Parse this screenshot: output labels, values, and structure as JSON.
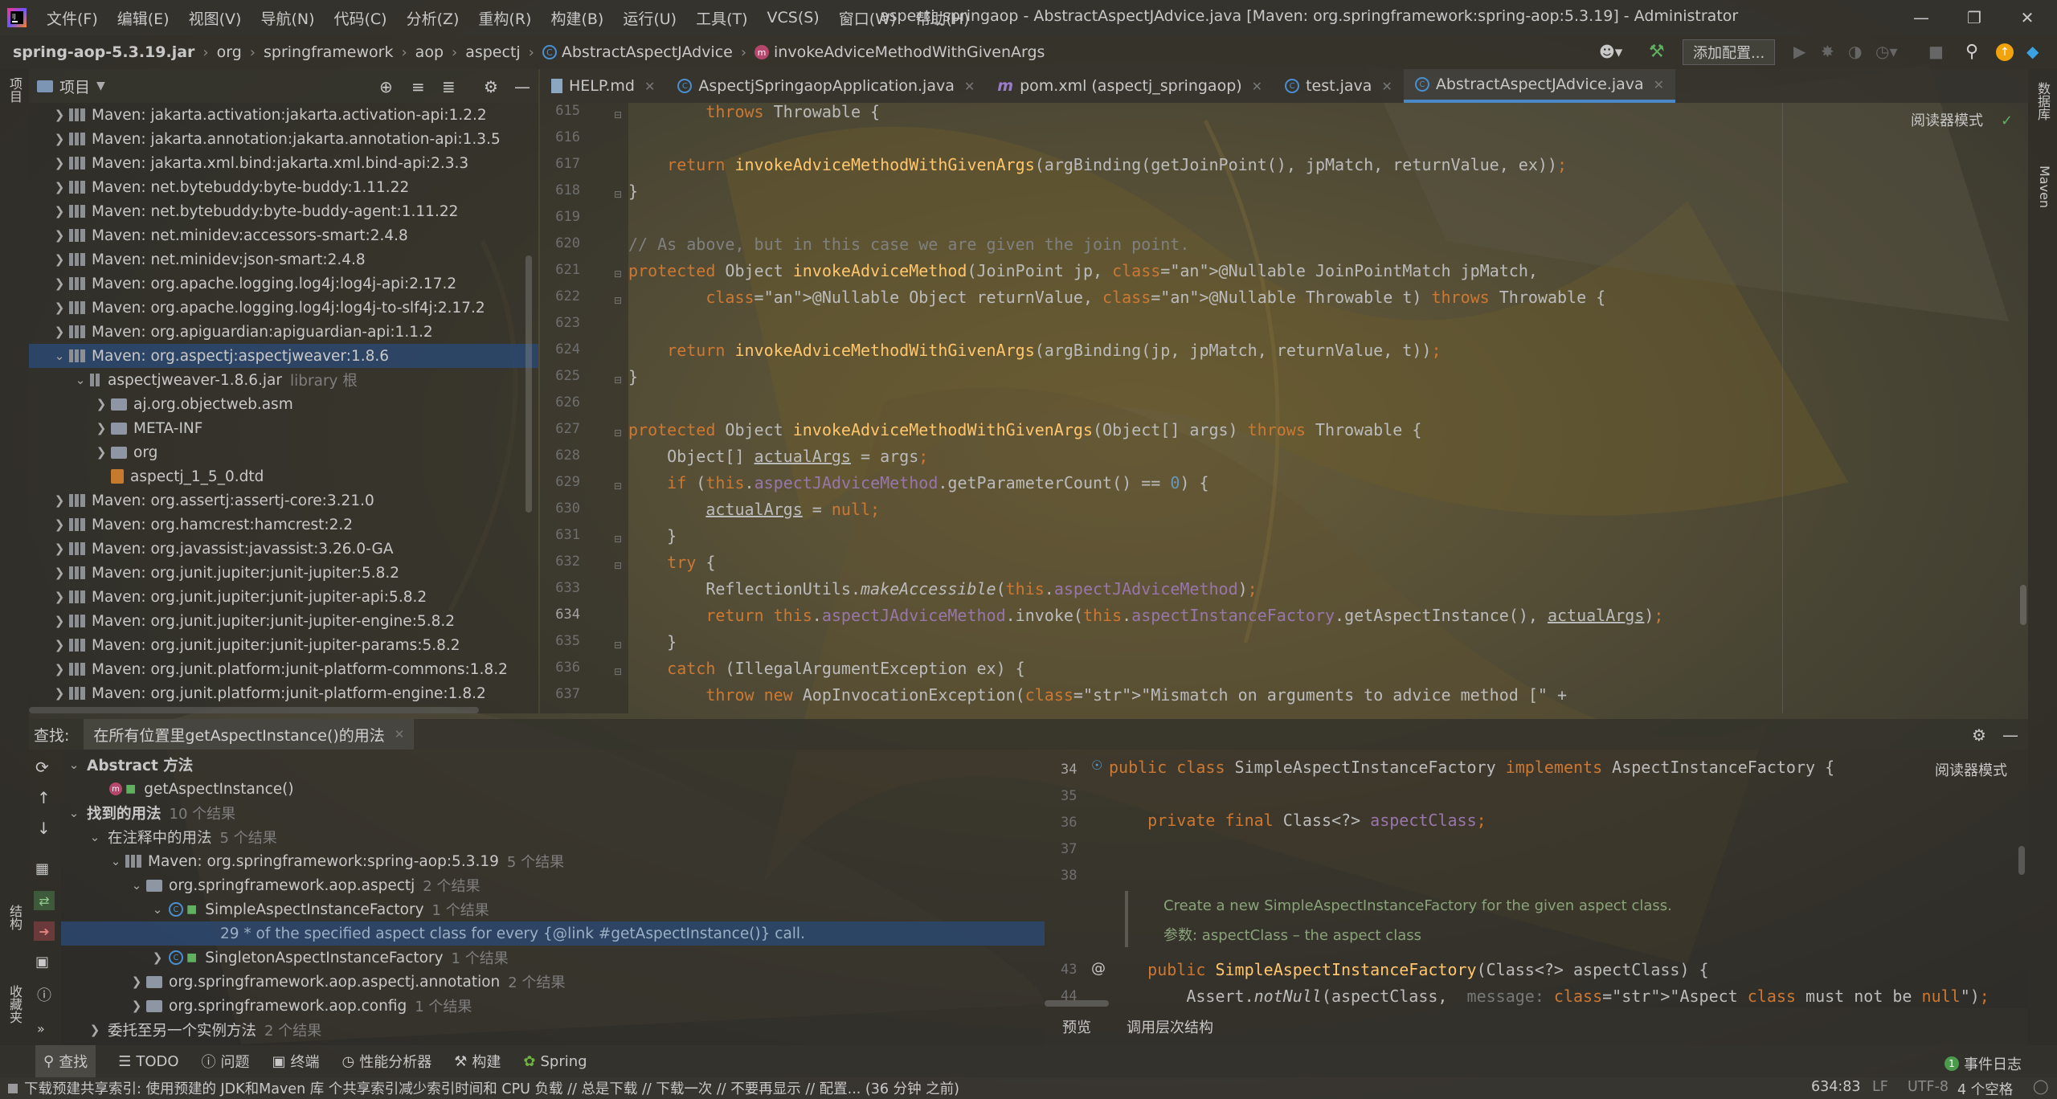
{
  "titlebar": {
    "menu": [
      "文件(F)",
      "编辑(E)",
      "视图(V)",
      "导航(N)",
      "代码(C)",
      "分析(Z)",
      "重构(R)",
      "构建(B)",
      "运行(U)",
      "工具(T)",
      "VCS(S)",
      "窗口(W)",
      "帮助(H)"
    ],
    "title": "aspectj_springaop - AbstractAspectJAdvice.java [Maven: org.springframework:spring-aop:5.3.19] - Administrator"
  },
  "navbar": {
    "crumbs": [
      "spring-aop-5.3.19.jar",
      "org",
      "springframework",
      "aop",
      "aspectj",
      "AbstractAspectJAdvice",
      "invokeAdviceMethodWithGivenArgs"
    ],
    "config_button": "添加配置..."
  },
  "project": {
    "title": "项目",
    "items": [
      {
        "label": "Maven: jakarta.activation:jakarta.activation-api:1.2.2"
      },
      {
        "label": "Maven: jakarta.annotation:jakarta.annotation-api:1.3.5"
      },
      {
        "label": "Maven: jakarta.xml.bind:jakarta.xml.bind-api:2.3.3"
      },
      {
        "label": "Maven: net.bytebuddy:byte-buddy:1.11.22"
      },
      {
        "label": "Maven: net.bytebuddy:byte-buddy-agent:1.11.22"
      },
      {
        "label": "Maven: net.minidev:accessors-smart:2.4.8"
      },
      {
        "label": "Maven: net.minidev:json-smart:2.4.8"
      },
      {
        "label": "Maven: org.apache.logging.log4j:log4j-api:2.17.2"
      },
      {
        "label": "Maven: org.apache.logging.log4j:log4j-to-slf4j:2.17.2"
      },
      {
        "label": "Maven: org.apiguardian:apiguardian-api:1.1.2"
      },
      {
        "label": "Maven: org.aspectj:aspectjweaver:1.8.6"
      },
      {
        "label": "aspectjweaver-1.8.6.jar",
        "suffix": "library 根"
      },
      {
        "label": "aj.org.objectweb.asm"
      },
      {
        "label": "META-INF"
      },
      {
        "label": "org"
      },
      {
        "label": "aspectj_1_5_0.dtd"
      },
      {
        "label": "Maven: org.assertj:assertj-core:3.21.0"
      },
      {
        "label": "Maven: org.hamcrest:hamcrest:2.2"
      },
      {
        "label": "Maven: org.javassist:javassist:3.26.0-GA"
      },
      {
        "label": "Maven: org.junit.jupiter:junit-jupiter:5.8.2"
      },
      {
        "label": "Maven: org.junit.jupiter:junit-jupiter-api:5.8.2"
      },
      {
        "label": "Maven: org.junit.jupiter:junit-jupiter-engine:5.8.2"
      },
      {
        "label": "Maven: org.junit.jupiter:junit-jupiter-params:5.8.2"
      },
      {
        "label": "Maven: org.junit.platform:junit-platform-commons:1.8.2"
      },
      {
        "label": "Maven: org.junit.platform:junit-platform-engine:1.8.2"
      }
    ]
  },
  "editor": {
    "tabs": [
      {
        "label": "HELP.md"
      },
      {
        "label": "AspectjSpringaopApplication.java"
      },
      {
        "label": "pom.xml (aspectj_springaop)"
      },
      {
        "label": "test.java"
      },
      {
        "label": "AbstractAspectJAdvice.java"
      }
    ],
    "reader_mode": "阅读器模式",
    "line_numbers": [
      "615",
      "616",
      "617",
      "618",
      "619",
      "620",
      "621",
      "622",
      "623",
      "624",
      "625",
      "626",
      "627",
      "628",
      "629",
      "630",
      "631",
      "632",
      "633",
      "634",
      "635",
      "636",
      "637"
    ],
    "lines": [
      "\t\tthrows Throwable {",
      "",
      "\treturn invokeAdviceMethodWithGivenArgs(argBinding(getJoinPoint(), jpMatch, returnValue, ex));",
      "}",
      "",
      "// As above, but in this case we are given the join point.",
      "protected Object invokeAdviceMethod(JoinPoint jp, @Nullable JoinPointMatch jpMatch,",
      "\t\t@Nullable Object returnValue, @Nullable Throwable t) throws Throwable {",
      "",
      "\treturn invokeAdviceMethodWithGivenArgs(argBinding(jp, jpMatch, returnValue, t));",
      "}",
      "",
      "protected Object invokeAdviceMethodWithGivenArgs(Object[] args) throws Throwable {",
      "\tObject[] actualArgs = args;",
      "\tif (this.aspectJAdviceMethod.getParameterCount() == 0) {",
      "\t\tactualArgs = null;",
      "\t}",
      "\ttry {",
      "\t\tReflectionUtils.makeAccessible(this.aspectJAdviceMethod);",
      "\t\treturn this.aspectJAdviceMethod.invoke(this.aspectInstanceFactory.getAspectInstance(), actualArgs);",
      "\t}",
      "\tcatch (IllegalArgumentException ex) {",
      "\t\tthrow new AopInvocationException(\"Mismatch on arguments to advice method [\" +"
    ]
  },
  "find": {
    "label": "查找:",
    "tab": "在所有位置里getAspectInstance()的用法",
    "rows": [
      {
        "label": "Abstract 方法",
        "count": ""
      },
      {
        "label": "getAspectInstance()",
        "count": ""
      },
      {
        "label": "找到的用法",
        "count": "10 个结果"
      },
      {
        "label": "在注释中的用法",
        "count": "5 个结果"
      },
      {
        "label": "Maven: org.springframework:spring-aop:5.3.19",
        "count": "5 个结果"
      },
      {
        "label": "org.springframework.aop.aspectj",
        "count": "2 个结果"
      },
      {
        "label": "SimpleAspectInstanceFactory",
        "count": "1 个结果"
      },
      {
        "label": "29 * of the specified aspect class for every {@link #getAspectInstance()} call.",
        "count": ""
      },
      {
        "label": "SingletonAspectInstanceFactory",
        "count": "1 个结果"
      },
      {
        "label": "org.springframework.aop.aspectj.annotation",
        "count": "2 个结果"
      },
      {
        "label": "org.springframework.aop.config",
        "count": "1 个结果"
      },
      {
        "label": "委托至另一个实例方法",
        "count": "2 个结果"
      }
    ],
    "preview": {
      "reader_mode": "阅读器模式",
      "line_numbers": [
        "34",
        "35",
        "36",
        "37",
        "38",
        "",
        "",
        "43",
        "44"
      ],
      "class_line": "public class SimpleAspectInstanceFactory implements AspectInstanceFactory {",
      "field_line": "private final Class<?> aspectClass;",
      "doc_line1": "Create a new SimpleAspectInstanceFactory for the given aspect class.",
      "doc_line2": "参数: aspectClass – the aspect class",
      "ctor_line": "public SimpleAspectInstanceFactory(Class<?> aspectClass) {",
      "assert_line": "Assert.notNull(aspectClass,  message: \"Aspect class must not be null\");"
    },
    "preview_tabs": [
      "预览",
      "调用层次结构"
    ]
  },
  "toolwindows": [
    "查找",
    "TODO",
    "问题",
    "终端",
    "性能分析器",
    "构建",
    "Spring"
  ],
  "event_log": "事件日志",
  "left_strip": [
    "项目",
    "结构",
    "收藏夹"
  ],
  "right_strip": [
    "数据库",
    "Maven"
  ],
  "status": {
    "message": "下载预建共享索引: 使用预建的 JDK和Maven 库 个共享索引减少索引时间和 CPU 负载 // 总是下载 // 下载一次 // 不要再显示 // 配置... (36 分钟 之前)",
    "position": "634:83",
    "line_sep": "LF",
    "encoding": "UTF-8",
    "indent": "4 个空格"
  }
}
